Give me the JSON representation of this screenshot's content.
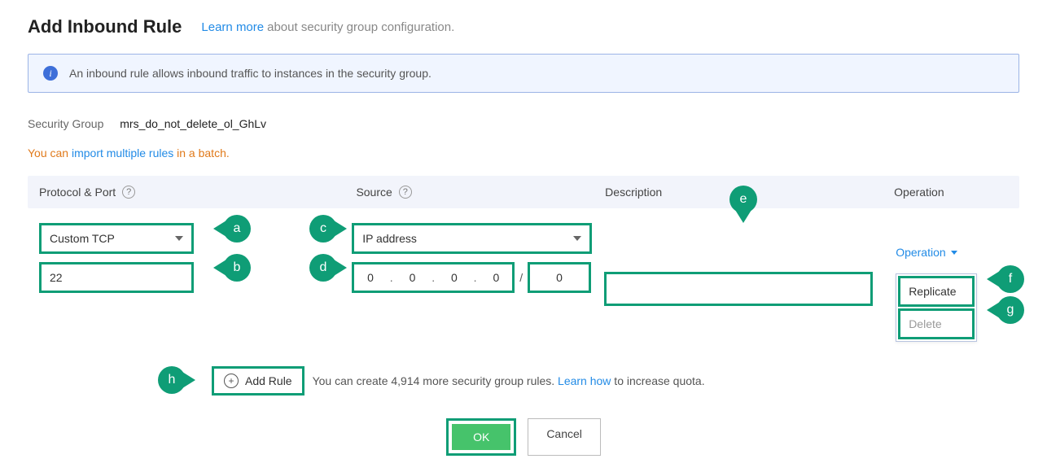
{
  "header": {
    "title": "Add Inbound Rule",
    "learn_more": "Learn more",
    "learn_more_rest": "about security group configuration."
  },
  "banner": {
    "text": "An inbound rule allows inbound traffic to instances in the security group."
  },
  "security_group": {
    "label": "Security Group",
    "value": "mrs_do_not_delete_ol_GhLv"
  },
  "import_hint": {
    "prefix": "You can ",
    "link": "import multiple rules",
    "suffix": " in a batch."
  },
  "columns": {
    "protocol": "Protocol & Port",
    "source": "Source",
    "description": "Description",
    "operation": "Operation"
  },
  "rule": {
    "protocol_select": "Custom TCP",
    "port": "22",
    "source_select": "IP address",
    "ip_octets": [
      "0",
      "0",
      "0",
      "0"
    ],
    "ip_mask": "0",
    "description": ""
  },
  "operation_menu": {
    "trigger": "Operation",
    "replicate": "Replicate",
    "delete": "Delete"
  },
  "add_rule": {
    "button": "Add Rule",
    "quota_prefix": "You can create 4,914 more security group rules. ",
    "quota_link": "Learn how",
    "quota_suffix": " to increase quota."
  },
  "footer": {
    "ok": "OK",
    "cancel": "Cancel"
  },
  "markers": {
    "a": "a",
    "b": "b",
    "c": "c",
    "d": "d",
    "e": "e",
    "f": "f",
    "g": "g",
    "h": "h"
  }
}
